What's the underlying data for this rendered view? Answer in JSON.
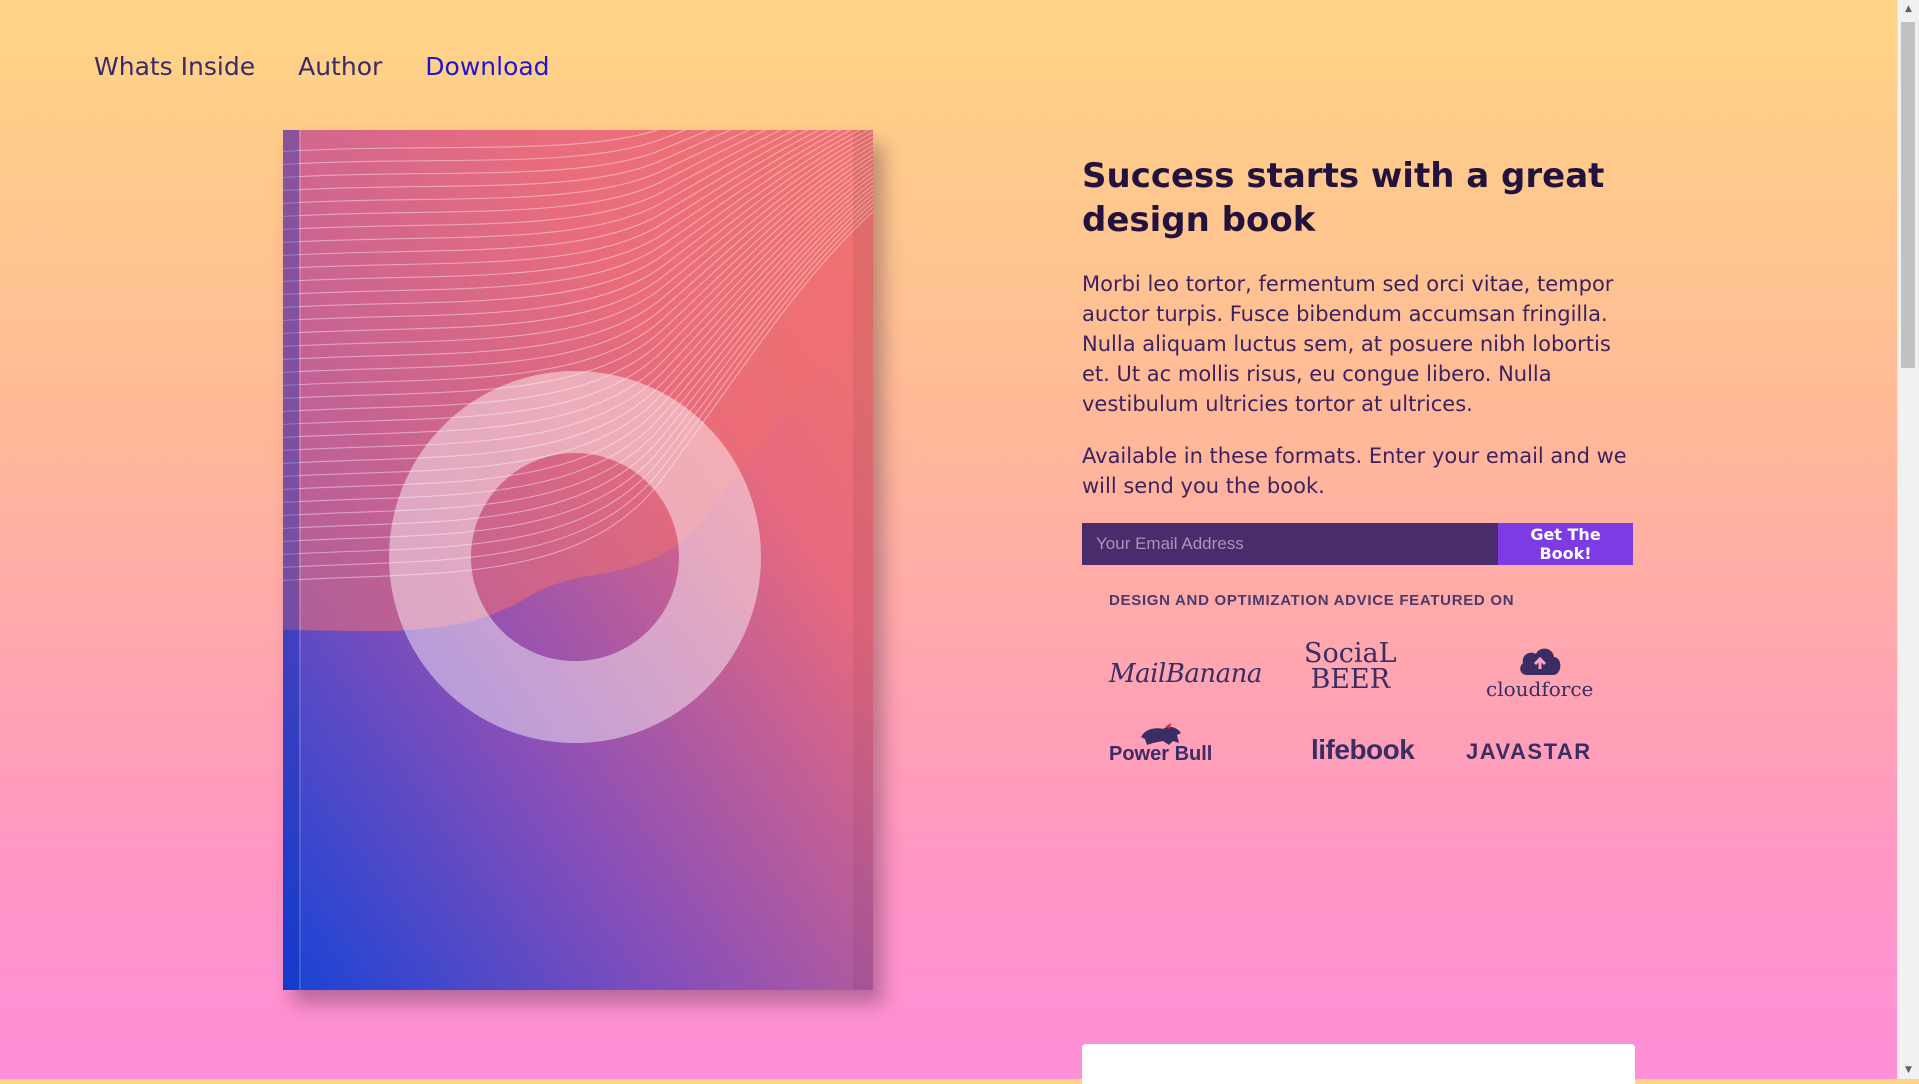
{
  "nav": {
    "items": [
      {
        "label": "Whats Inside",
        "active": false
      },
      {
        "label": "Author",
        "active": false
      },
      {
        "label": "Download",
        "active": true
      }
    ],
    "active_color": "#2015d6"
  },
  "hero": {
    "title": "Success starts with a great design book",
    "description": "Morbi leo tortor, fermentum sed orci vitae, tempor auctor turpis. Fusce bibendum accumsan fringilla. Nulla aliquam luctus sem, at posuere nibh lobortis et. Ut ac mollis risus, eu congue libero. Nulla vestibulum ultricies tortor at ultrices.",
    "formats_text": "Available in these formats. Enter your email and we will send you the book."
  },
  "form": {
    "email_placeholder": "Your Email Address",
    "email_value": "",
    "submit_label": "Get The Book!"
  },
  "featured": {
    "heading": "DESIGN AND OPTIMIZATION ADVICE FEATURED ON",
    "logos": {
      "mailbanana": "MailBanana",
      "socialbeer_line1": "SociaL",
      "socialbeer_line2": "BEER",
      "cloudforce": "cloudforce",
      "powerbull": "Power Bull",
      "lifebook": "lifebook",
      "javastar": "JAVASTAR"
    }
  },
  "colors": {
    "bg_top": "#ffd585",
    "bg_bottom": "#ff8fd8",
    "heading": "#23123d",
    "input_bg": "#4a2b6b",
    "button_bg": "#7d3be6"
  },
  "icons": {
    "scroll_up": "▲",
    "scroll_down": "▼"
  }
}
